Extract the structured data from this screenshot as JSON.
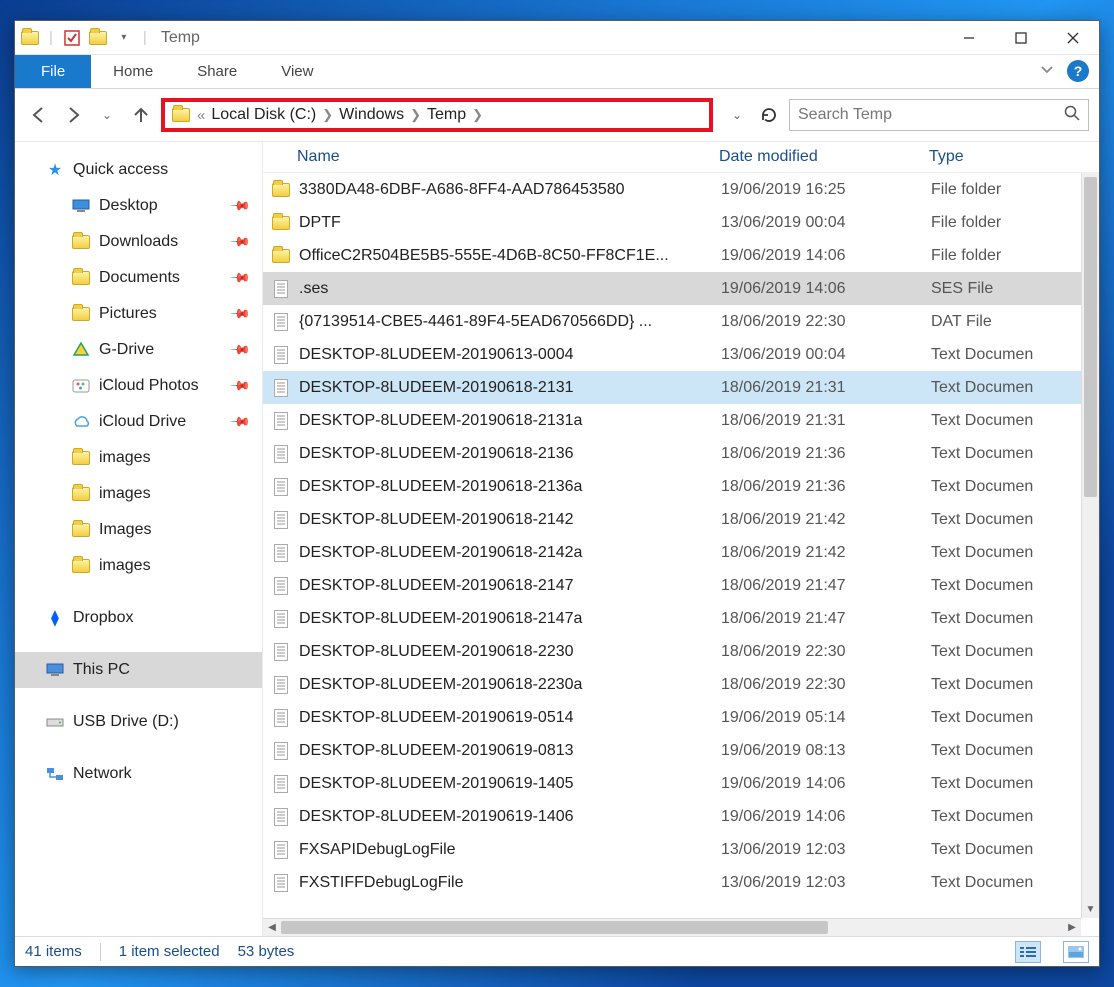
{
  "title": "Temp",
  "ribbon": {
    "file": "File",
    "tabs": [
      "Home",
      "Share",
      "View"
    ]
  },
  "breadcrumb": [
    "Local Disk (C:)",
    "Windows",
    "Temp"
  ],
  "search_placeholder": "Search Temp",
  "columns": {
    "name": "Name",
    "date": "Date modified",
    "type": "Type"
  },
  "sidebar": {
    "quick": "Quick access",
    "items": [
      {
        "label": "Desktop",
        "pin": true,
        "icon": "desktop"
      },
      {
        "label": "Downloads",
        "pin": true,
        "icon": "folder"
      },
      {
        "label": "Documents",
        "pin": true,
        "icon": "folder"
      },
      {
        "label": "Pictures",
        "pin": true,
        "icon": "folder"
      },
      {
        "label": "G-Drive",
        "pin": true,
        "icon": "gdrive"
      },
      {
        "label": "iCloud Photos",
        "pin": true,
        "icon": "icloudp"
      },
      {
        "label": "iCloud Drive",
        "pin": true,
        "icon": "icloud"
      },
      {
        "label": "images",
        "pin": false,
        "icon": "folder"
      },
      {
        "label": "images",
        "pin": false,
        "icon": "folder"
      },
      {
        "label": "Images",
        "pin": false,
        "icon": "folder"
      },
      {
        "label": "images",
        "pin": false,
        "icon": "folder"
      }
    ],
    "dropbox": "Dropbox",
    "thispc": "This PC",
    "usb": "USB Drive (D:)",
    "network": "Network"
  },
  "files": [
    {
      "name": "3380DA48-6DBF-A686-8FF4-AAD786453580",
      "date": "19/06/2019 16:25",
      "type": "File folder",
      "icon": "folder"
    },
    {
      "name": "DPTF",
      "date": "13/06/2019 00:04",
      "type": "File folder",
      "icon": "folder"
    },
    {
      "name": "OfficeC2R504BE5B5-555E-4D6B-8C50-FF8CF1E...",
      "date": "19/06/2019 14:06",
      "type": "File folder",
      "icon": "folder"
    },
    {
      "name": ".ses",
      "date": "19/06/2019 14:06",
      "type": "SES File",
      "icon": "file",
      "hl": true
    },
    {
      "name": "{07139514-CBE5-4461-89F4-5EAD670566DD} ...",
      "date": "18/06/2019 22:30",
      "type": "DAT File",
      "icon": "file"
    },
    {
      "name": "DESKTOP-8LUDEEM-20190613-0004",
      "date": "13/06/2019 00:04",
      "type": "Text Documen",
      "icon": "file"
    },
    {
      "name": "DESKTOP-8LUDEEM-20190618-2131",
      "date": "18/06/2019 21:31",
      "type": "Text Documen",
      "icon": "file",
      "sel": true
    },
    {
      "name": "DESKTOP-8LUDEEM-20190618-2131a",
      "date": "18/06/2019 21:31",
      "type": "Text Documen",
      "icon": "file"
    },
    {
      "name": "DESKTOP-8LUDEEM-20190618-2136",
      "date": "18/06/2019 21:36",
      "type": "Text Documen",
      "icon": "file"
    },
    {
      "name": "DESKTOP-8LUDEEM-20190618-2136a",
      "date": "18/06/2019 21:36",
      "type": "Text Documen",
      "icon": "file"
    },
    {
      "name": "DESKTOP-8LUDEEM-20190618-2142",
      "date": "18/06/2019 21:42",
      "type": "Text Documen",
      "icon": "file"
    },
    {
      "name": "DESKTOP-8LUDEEM-20190618-2142a",
      "date": "18/06/2019 21:42",
      "type": "Text Documen",
      "icon": "file"
    },
    {
      "name": "DESKTOP-8LUDEEM-20190618-2147",
      "date": "18/06/2019 21:47",
      "type": "Text Documen",
      "icon": "file"
    },
    {
      "name": "DESKTOP-8LUDEEM-20190618-2147a",
      "date": "18/06/2019 21:47",
      "type": "Text Documen",
      "icon": "file"
    },
    {
      "name": "DESKTOP-8LUDEEM-20190618-2230",
      "date": "18/06/2019 22:30",
      "type": "Text Documen",
      "icon": "file"
    },
    {
      "name": "DESKTOP-8LUDEEM-20190618-2230a",
      "date": "18/06/2019 22:30",
      "type": "Text Documen",
      "icon": "file"
    },
    {
      "name": "DESKTOP-8LUDEEM-20190619-0514",
      "date": "19/06/2019 05:14",
      "type": "Text Documen",
      "icon": "file"
    },
    {
      "name": "DESKTOP-8LUDEEM-20190619-0813",
      "date": "19/06/2019 08:13",
      "type": "Text Documen",
      "icon": "file"
    },
    {
      "name": "DESKTOP-8LUDEEM-20190619-1405",
      "date": "19/06/2019 14:06",
      "type": "Text Documen",
      "icon": "file"
    },
    {
      "name": "DESKTOP-8LUDEEM-20190619-1406",
      "date": "19/06/2019 14:06",
      "type": "Text Documen",
      "icon": "file"
    },
    {
      "name": "FXSAPIDebugLogFile",
      "date": "13/06/2019 12:03",
      "type": "Text Documen",
      "icon": "file"
    },
    {
      "name": "FXSTIFFDebugLogFile",
      "date": "13/06/2019 12:03",
      "type": "Text Documen",
      "icon": "file"
    }
  ],
  "status": {
    "count": "41 items",
    "sel": "1 item selected",
    "size": "53 bytes"
  }
}
